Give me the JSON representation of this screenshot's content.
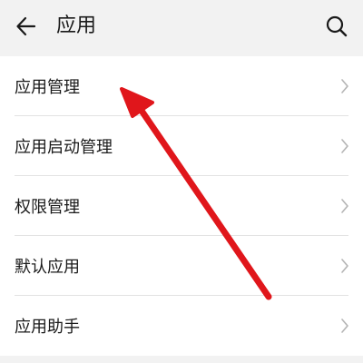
{
  "header": {
    "title": "应用",
    "back_icon": "arrow-left-icon",
    "search_icon": "search-icon"
  },
  "menu": {
    "items": [
      {
        "label": "应用管理"
      },
      {
        "label": "应用启动管理"
      },
      {
        "label": "权限管理"
      },
      {
        "label": "默认应用"
      },
      {
        "label": "应用助手"
      }
    ]
  },
  "annotation": {
    "arrow_color": "#e0161b",
    "chevron_icon": "chevron-right-icon"
  }
}
